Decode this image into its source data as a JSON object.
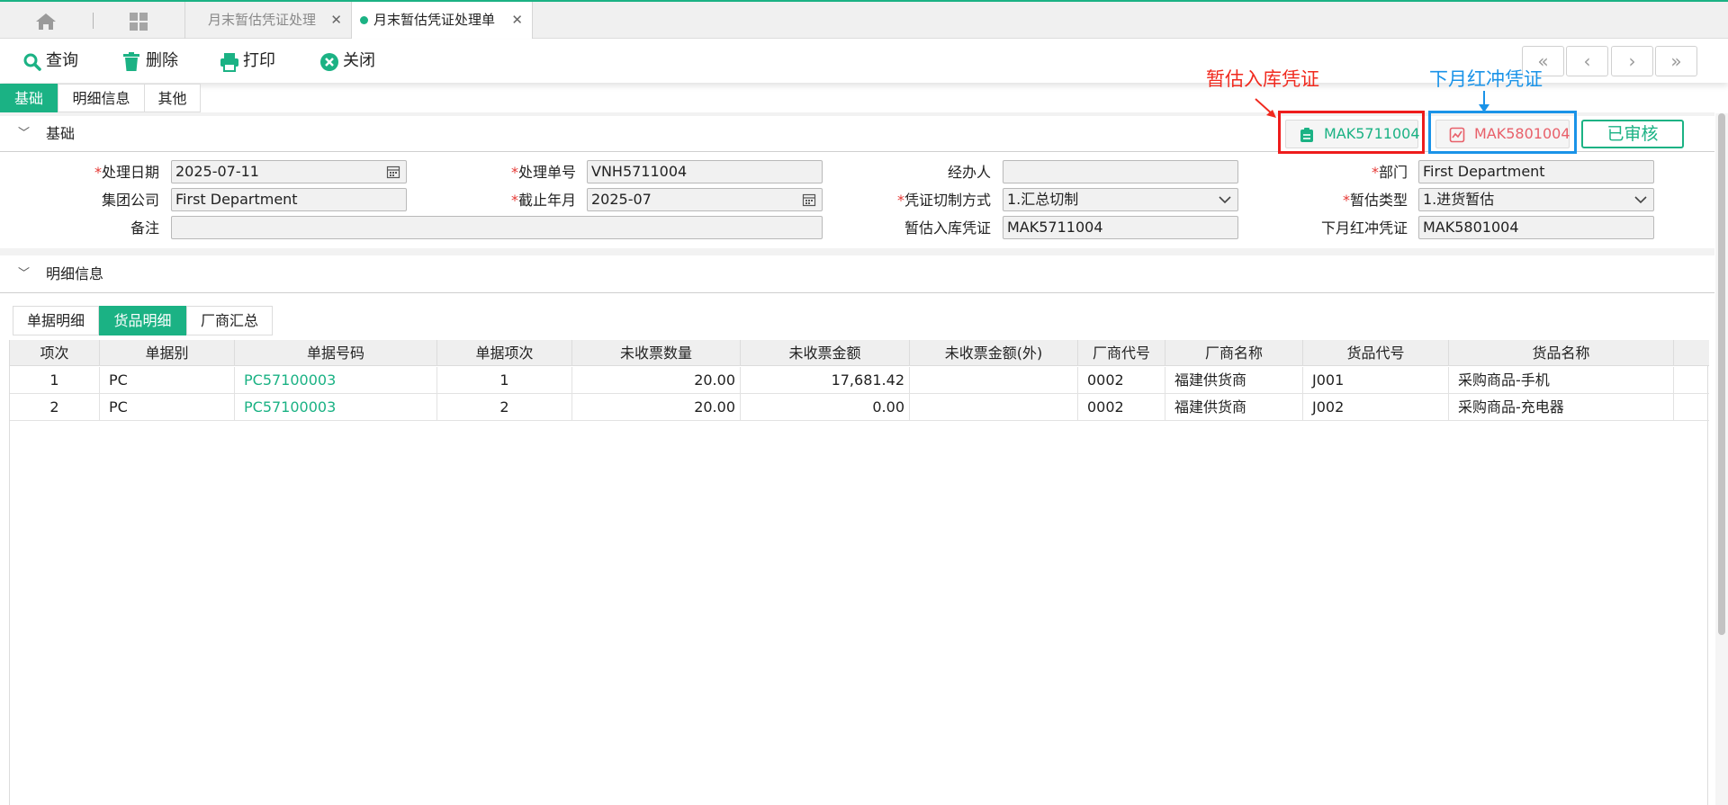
{
  "tabs": [
    {
      "label": "月末暂估凭证处理"
    },
    {
      "label": "月末暂估凭证处理单"
    }
  ],
  "toolbar": {
    "query": "查询",
    "delete": "删除",
    "print": "打印",
    "close": "关闭"
  },
  "section_tabs": [
    "基础",
    "明细信息",
    "其他"
  ],
  "sections": {
    "basic": "基础",
    "detail": "明细信息"
  },
  "annotations": {
    "estimate_voucher_label": "暂估入库凭证",
    "reversal_voucher_label": "下月红冲凭证"
  },
  "voucher_buttons": {
    "estimate": "MAK5711004",
    "reversal": "MAK5801004"
  },
  "status": "已审核",
  "form": {
    "process_date": {
      "label": "处理日期",
      "value": "2025-07-11"
    },
    "process_no": {
      "label": "处理单号",
      "value": "VNH5711004"
    },
    "handler": {
      "label": "经办人",
      "value": ""
    },
    "department": {
      "label": "部门",
      "value": "First Department"
    },
    "group_company": {
      "label": "集团公司",
      "value": "First Department"
    },
    "cutoff_month": {
      "label": "截止年月",
      "value": "2025-07"
    },
    "voucher_split": {
      "label": "凭证切制方式",
      "value": "1.汇总切制"
    },
    "estimate_type": {
      "label": "暂估类型",
      "value": "1.进货暂估"
    },
    "remark": {
      "label": "备注",
      "value": ""
    },
    "estimate_voucher": {
      "label": "暂估入库凭证",
      "value": "MAK5711004"
    },
    "reversal_voucher": {
      "label": "下月红冲凭证",
      "value": "MAK5801004"
    }
  },
  "detail_tabs": [
    "单据明细",
    "货品明细",
    "厂商汇总"
  ],
  "grid": {
    "columns": [
      "项次",
      "单据别",
      "单据号码",
      "单据项次",
      "未收票数量",
      "未收票金额",
      "未收票金额(外)",
      "厂商代号",
      "厂商名称",
      "货品代号",
      "货品名称"
    ],
    "rows": [
      [
        "1",
        "PC",
        "PC57100003",
        "1",
        "20.00",
        "17,681.42",
        "",
        "0002",
        "福建供货商",
        "J001",
        "采购商品-手机"
      ],
      [
        "2",
        "PC",
        "PC57100003",
        "2",
        "20.00",
        "0.00",
        "",
        "0002",
        "福建供货商",
        "J002",
        "采购商品-充电器"
      ]
    ]
  },
  "colors": {
    "accent": "#1bb284",
    "annotation_red": "#f02a1f",
    "annotation_blue": "#1a93e8"
  }
}
